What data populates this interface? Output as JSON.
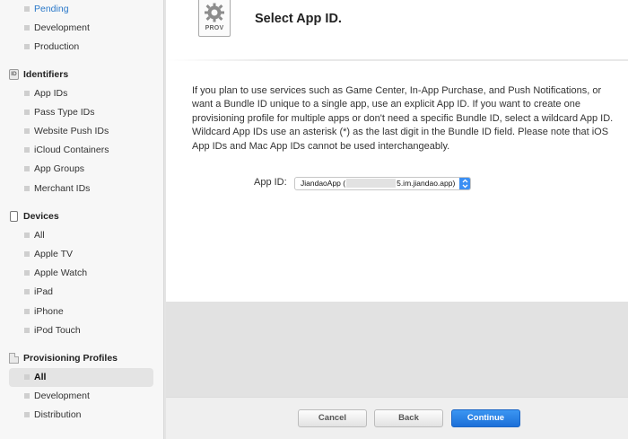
{
  "sidebar": {
    "certificates_items": [
      {
        "label": "Pending"
      },
      {
        "label": "Development"
      },
      {
        "label": "Production"
      }
    ],
    "identifiers": {
      "title": "Identifiers",
      "icon_text": "ID",
      "items": [
        {
          "label": "App IDs"
        },
        {
          "label": "Pass Type IDs"
        },
        {
          "label": "Website Push IDs"
        },
        {
          "label": "iCloud Containers"
        },
        {
          "label": "App Groups"
        },
        {
          "label": "Merchant IDs"
        }
      ]
    },
    "devices": {
      "title": "Devices",
      "items": [
        {
          "label": "All"
        },
        {
          "label": "Apple TV"
        },
        {
          "label": "Apple Watch"
        },
        {
          "label": "iPad"
        },
        {
          "label": "iPhone"
        },
        {
          "label": "iPod Touch"
        }
      ]
    },
    "provisioning": {
      "title": "Provisioning Profiles",
      "items": [
        {
          "label": "All"
        },
        {
          "label": "Development"
        },
        {
          "label": "Distribution"
        }
      ]
    }
  },
  "main": {
    "file_icon_label": "PROV",
    "title": "Select App ID.",
    "description": "If you plan to use services such as Game Center, In-App Purchase, and Push Notifications, or want a Bundle ID unique to a single app, use an explicit App ID. If you want to create one provisioning profile for multiple apps or don't need a specific Bundle ID, select a wildcard App ID. Wildcard App IDs use an asterisk (*) as the last digit in the Bundle ID field. Please note that iOS App IDs and Mac App IDs cannot be used interchangeably.",
    "app_id_label": "App ID:",
    "app_id_value_prefix": "JiandaoApp (",
    "app_id_value_suffix": "5.im.jiandao.app)"
  },
  "footer": {
    "cancel_label": "Cancel",
    "back_label": "Back",
    "continue_label": "Continue"
  },
  "colors": {
    "accent": "#2a78c9",
    "primary_button": "#1f74e0",
    "sidebar_bg": "#f7f7f7",
    "selected_item_bg": "#e4e4e4",
    "grey_band": "#e2e2e2"
  }
}
